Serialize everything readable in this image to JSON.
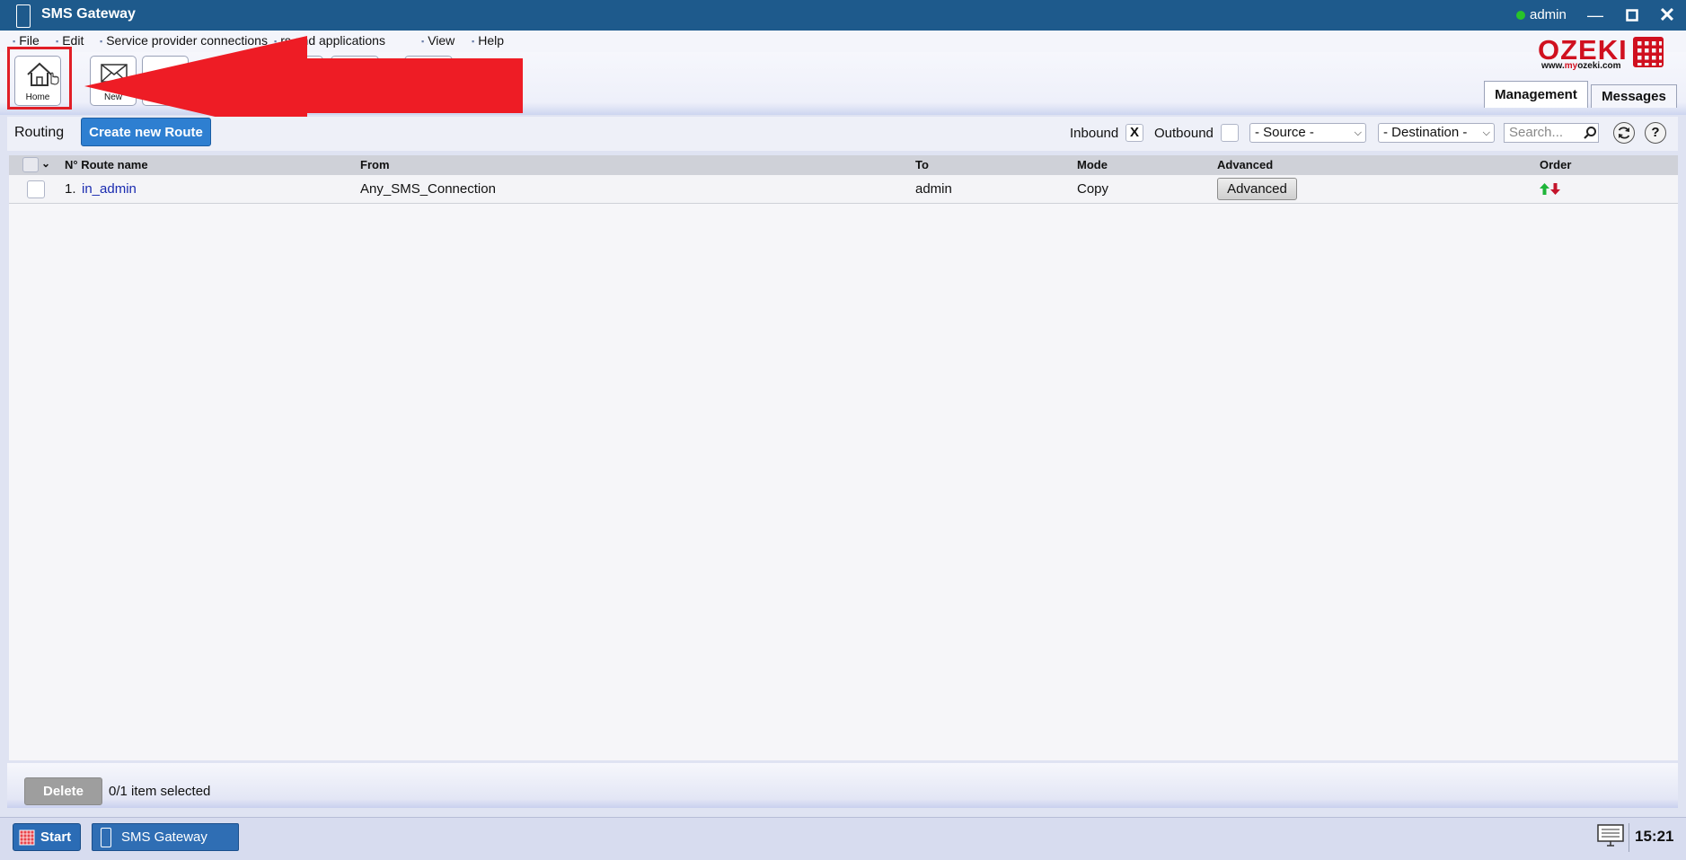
{
  "window": {
    "title": "SMS Gateway",
    "user": "admin",
    "minimize_icon": "minimize-icon",
    "maximize_icon": "maximize-icon",
    "close_icon": "close-icon"
  },
  "menu": [
    "File",
    "Edit",
    "Service provider connections",
    "rs and applications",
    "View",
    "Help"
  ],
  "toolbar": {
    "home_label": "Home",
    "new_label": "New",
    "annotation_color": "#e11e26"
  },
  "logo": {
    "brand": "OZEKI",
    "url_prefix": "www.",
    "url_accent": "my",
    "url_suffix": "ozeki.com"
  },
  "tabs": {
    "management": "Management",
    "messages": "Messages"
  },
  "routing": {
    "title": "Routing",
    "create_label": "Create new Route",
    "inbound_label": "Inbound",
    "inbound_value": "X",
    "outbound_label": "Outbound",
    "outbound_value": "",
    "source_select": "- Source -",
    "destination_select": "- Destination -",
    "search_placeholder": "Search..."
  },
  "table": {
    "headers": {
      "no_route": "N° Route name",
      "from": "From",
      "to": "To",
      "mode": "Mode",
      "advanced": "Advanced",
      "order": "Order"
    },
    "rows": [
      {
        "index": "1.",
        "name": "in_admin",
        "from": "Any_SMS_Connection",
        "to": "admin",
        "mode": "Copy",
        "advanced_label": "Advanced"
      }
    ]
  },
  "footer": {
    "delete_label": "Delete",
    "selection_text": "0/1 item selected"
  },
  "taskbar": {
    "start_label": "Start",
    "app_label": "SMS Gateway",
    "clock": "15:21"
  },
  "colors": {
    "titlebar": "#1e5a8c",
    "accent_blue": "#2e7fd1",
    "link": "#1a2bb0",
    "logo_red": "#d0101f"
  }
}
